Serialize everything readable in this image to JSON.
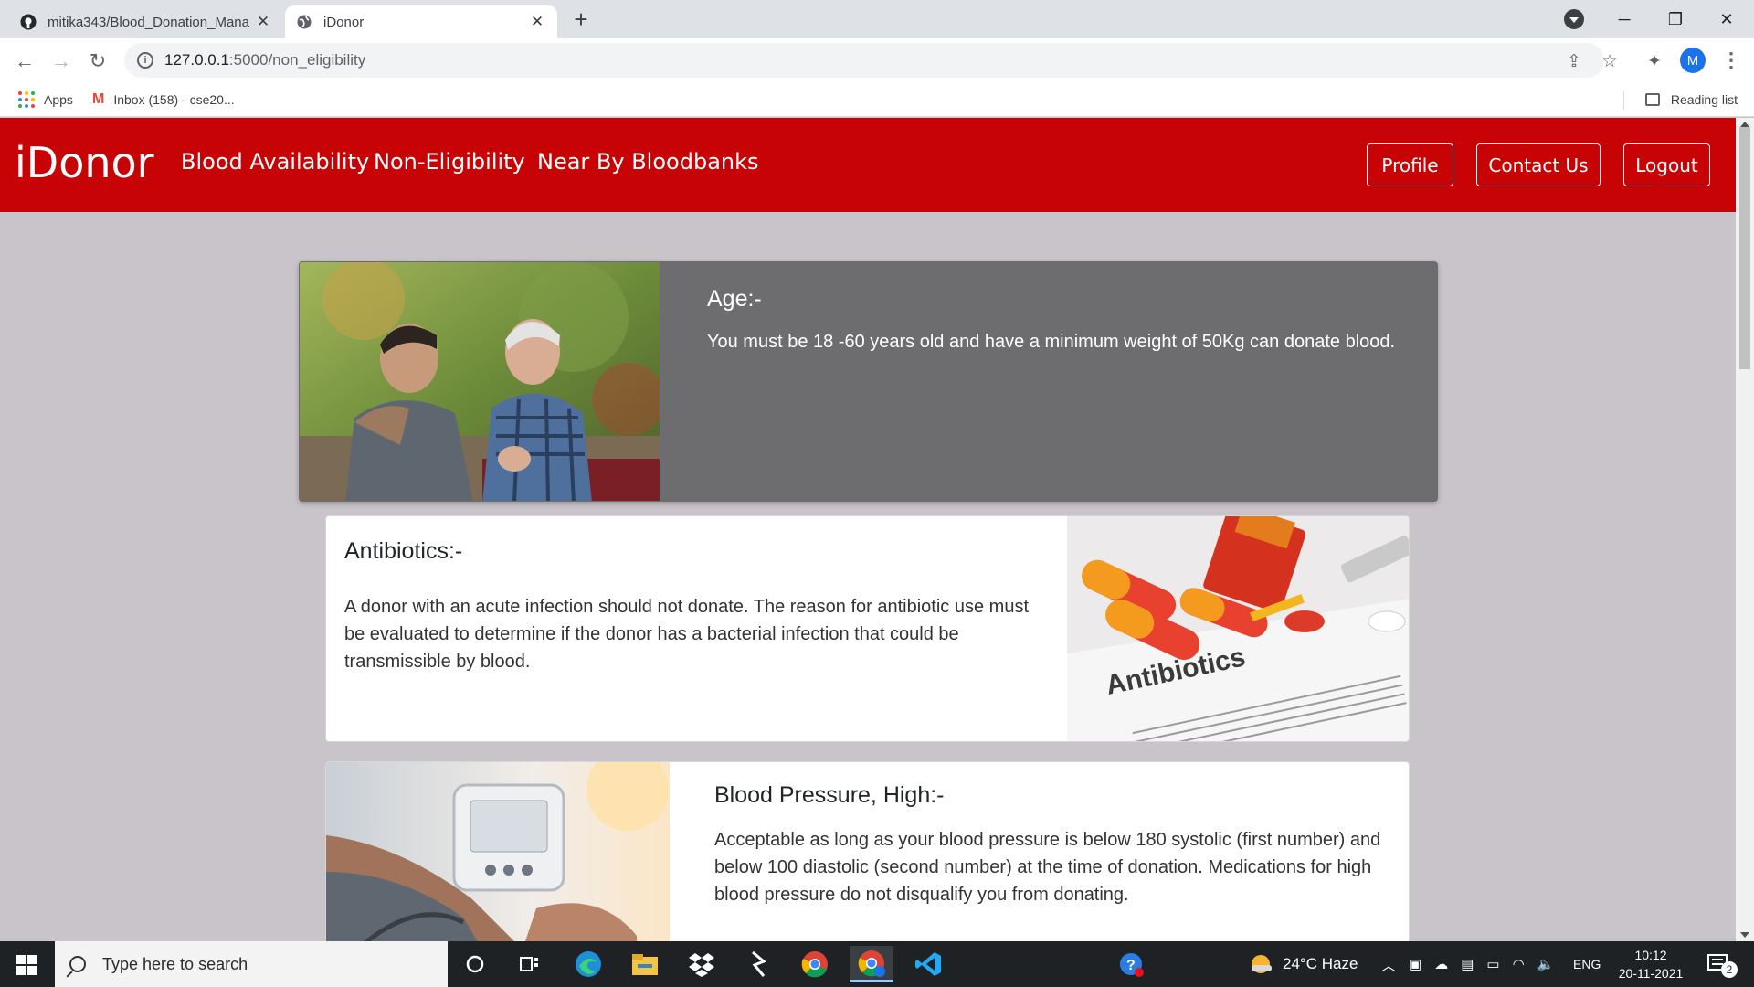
{
  "browser": {
    "tabs": [
      {
        "title": "mitika343/Blood_Donation_Mana",
        "active": false,
        "favicon": "github-icon"
      },
      {
        "title": "iDonor",
        "active": true,
        "favicon": "globe-icon"
      }
    ],
    "url_host": "127.0.0.1",
    "url_path": ":5000/non_eligibility",
    "profile_initial": "M",
    "bookmarks": {
      "apps_label": "Apps",
      "inbox_label": "Inbox (158) - cse20...",
      "reading_list_label": "Reading list"
    }
  },
  "site": {
    "brand": "iDonor",
    "nav_links": {
      "blood_availability": "Blood Availability",
      "non_eligibility": "Non-Eligibility",
      "bloodbanks": "Near By Bloodbanks"
    },
    "buttons": {
      "profile": "Profile",
      "contact": "Contact Us",
      "logout": "Logout"
    },
    "brand_color": "#c70306",
    "cards": [
      {
        "title": "Age:-",
        "text": "You must be 18 -60 years old and have a minimum weight of 50Kg can donate blood.",
        "image": "father-son-photo"
      },
      {
        "title": "Antibiotics:-",
        "text": "A donor with an acute infection should not donate. The reason for antibiotic use must be evaluated to determine if the donor has a bacterial infection that could be transmissible by blood.",
        "image": "antibiotics-pills-photo",
        "image_caption": "Antibiotics"
      },
      {
        "title": "Blood Pressure, High:-",
        "text": "Acceptable as long as your blood pressure is below 180 systolic (first number) and below 100 diastolic (second number) at the time of donation. Medications for high blood pressure do not disqualify you from donating.",
        "image": "blood-pressure-monitor-photo"
      }
    ]
  },
  "taskbar": {
    "search_placeholder": "Type here to search",
    "weather": "24°C  Haze",
    "language": "ENG",
    "time": "10:12",
    "date": "20-11-2021",
    "notification_count": "2"
  }
}
